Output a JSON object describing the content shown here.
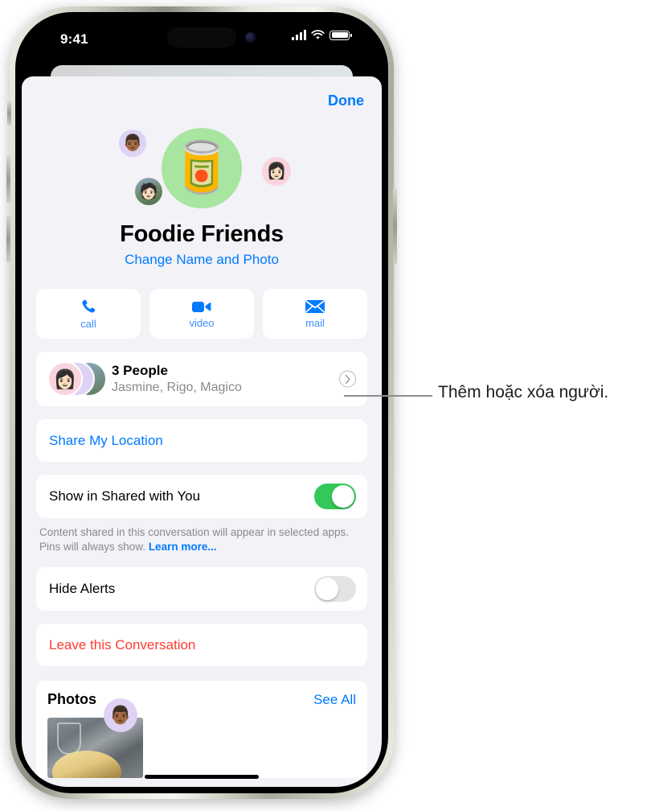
{
  "status_bar": {
    "time": "9:41",
    "cellular_icon": "signal-bars-icon",
    "wifi_icon": "wifi-icon",
    "battery_icon": "battery-icon"
  },
  "sheet": {
    "done_label": "Done",
    "group": {
      "emoji": "🥫",
      "name": "Foodie Friends",
      "change_link": "Change Name and Photo",
      "member_avatars": [
        "👨🏾",
        "👩🏻",
        "🧑🏻"
      ]
    },
    "actions": [
      {
        "label": "call",
        "icon": "phone-icon"
      },
      {
        "label": "video",
        "icon": "video-camera-icon"
      },
      {
        "label": "mail",
        "icon": "envelope-icon"
      }
    ],
    "people_row": {
      "title": "3 People",
      "subtitle": "Jasmine, Rigo, Magico",
      "chevron_icon": "chevron-right-icon"
    },
    "share_location_label": "Share My Location",
    "shared_with_you": {
      "label": "Show in Shared with You",
      "toggle_state": "on",
      "footnote": "Content shared in this conversation will appear in selected apps. Pins will always show. ",
      "footnote_link": "Learn more..."
    },
    "hide_alerts": {
      "label": "Hide Alerts",
      "toggle_state": "off"
    },
    "leave_label": "Leave this Conversation",
    "photos": {
      "title": "Photos",
      "see_all_label": "See All",
      "thumb_avatar": "👨🏾"
    }
  },
  "callout": {
    "text": "Thêm hoặc xóa người."
  },
  "colors": {
    "accent_blue": "#007aff",
    "destructive_red": "#ff3b30",
    "toggle_green": "#34c759",
    "sheet_background": "#f2f2f7",
    "group_circle": "#a8e5a0"
  }
}
